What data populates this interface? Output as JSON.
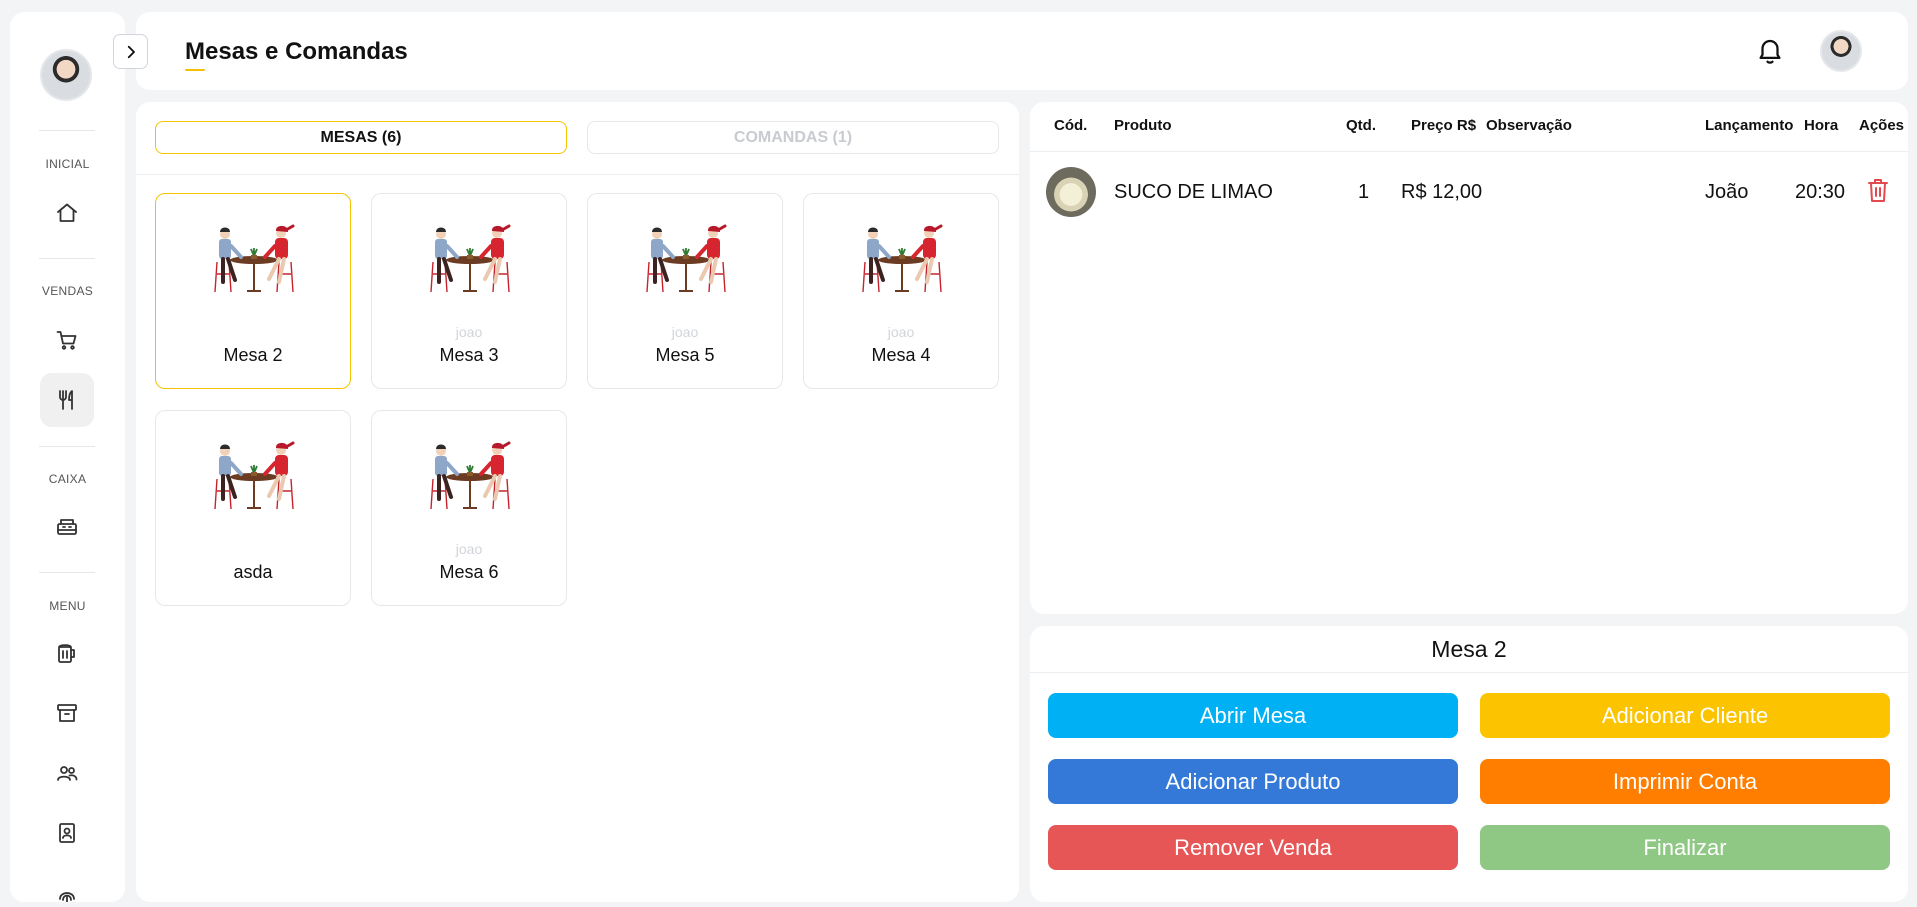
{
  "sidebar": {
    "sections": [
      "INICIAL",
      "VENDAS",
      "CAIXA",
      "MENU"
    ],
    "icons": [
      "home-icon",
      "cart-icon",
      "utensils-icon",
      "cash-register-icon",
      "beer-mug-icon",
      "archive-box-icon",
      "users-icon",
      "contact-book-icon",
      "fingerprint-icon"
    ]
  },
  "header": {
    "title": "Mesas e Comandas",
    "accent": "#f5c000"
  },
  "tabs": [
    {
      "label": "MESAS (6)",
      "active": true
    },
    {
      "label": "COMANDAS (1)",
      "active": false
    }
  ],
  "tables": [
    {
      "name": "Mesa 2",
      "user": "",
      "selected": true
    },
    {
      "name": "Mesa 3",
      "user": "joao",
      "selected": false
    },
    {
      "name": "Mesa 5",
      "user": "joao",
      "selected": false
    },
    {
      "name": "Mesa 4",
      "user": "joao",
      "selected": false
    },
    {
      "name": "asda",
      "user": "",
      "selected": false
    },
    {
      "name": "Mesa 6",
      "user": "joao",
      "selected": false
    }
  ],
  "items_table": {
    "columns": [
      "Cód.",
      "Produto",
      "Qtd.",
      "Preço R$",
      "Observação",
      "Lançamento",
      "Hora",
      "Ações"
    ],
    "rows": [
      {
        "product": "SUCO DE LIMAO",
        "qty": "1",
        "price": "R$ 12,00",
        "note": "",
        "launched_by": "João",
        "time": "20:30"
      }
    ]
  },
  "selected_table": "Mesa 2",
  "actions": [
    {
      "label": "Abrir Mesa",
      "color": "#00b0f5"
    },
    {
      "label": "Adicionar Cliente",
      "color": "#fcc400"
    },
    {
      "label": "Adicionar Produto",
      "color": "#3479d7"
    },
    {
      "label": "Imprimir Conta",
      "color": "#ff7e00"
    },
    {
      "label": "Remover Venda",
      "color": "#e65657"
    },
    {
      "label": "Finalizar",
      "color": "#8fc785"
    }
  ]
}
